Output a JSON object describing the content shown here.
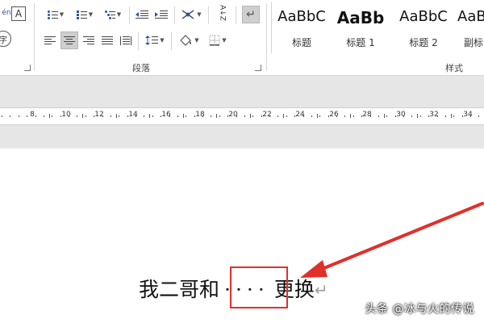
{
  "ribbon": {
    "left_edge": {
      "top_label": "én",
      "circle_char": "字",
      "boxed_char": "A"
    },
    "paragraph_group": {
      "label": "段落",
      "sort_icon_text": "A↓Z"
    },
    "styles_group": {
      "label": "样式",
      "tiles": [
        {
          "sample": "AaBbC",
          "name": "标题"
        },
        {
          "sample": "AaBb",
          "name": "标题 1"
        },
        {
          "sample": "AaBbC",
          "name": "标题 2"
        },
        {
          "sample": "AaBbC",
          "name": "副标"
        }
      ]
    }
  },
  "ruler": {
    "labels": [
      "8",
      "10",
      "12",
      "14",
      "16",
      "18",
      "20",
      "22",
      "24",
      "26",
      "28",
      "30",
      "32",
      "34"
    ]
  },
  "document": {
    "text_before": "我二哥和",
    "dots": "····",
    "text_after": "更换",
    "paragraph_mark": "↵"
  },
  "watermark": "头条 @冰与火的传说",
  "colors": {
    "highlight": "#e0302a",
    "arrow": "#e0302a",
    "ribbon_bg": "#ffffff",
    "band_bg": "#e6e6e6"
  }
}
